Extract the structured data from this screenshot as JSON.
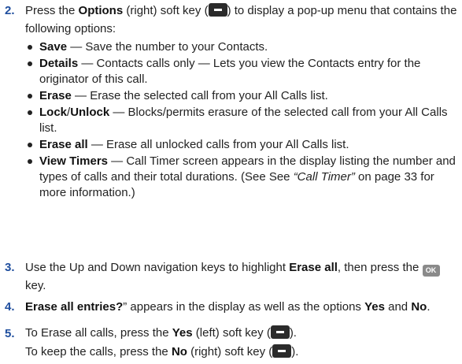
{
  "steps": {
    "s2": {
      "num": "2.",
      "p1": "Press the ",
      "b1": "Options",
      "p2": " (right) soft key (",
      "p3": ") to display a pop-up menu that contains the following options:",
      "bullets": [
        {
          "bold": "Save",
          "text": " — Save the number to your Contacts."
        },
        {
          "bold": "Details",
          "text": " — Contacts calls only — Lets you view the Contacts entry for the originator of this call."
        },
        {
          "bold": "Erase",
          "text": " — Erase the selected call from your All Calls list."
        },
        {
          "bold": "Lock",
          "slash": "/",
          "bold2": "Unlock",
          "text": " — Blocks/permits erasure of the selected call from your All Calls list."
        },
        {
          "bold": "Erase all",
          "text": " — Erase all unlocked calls from your All Calls list."
        },
        {
          "bold": "View Timers",
          "text": " — Call Timer screen appears in the display listing the number and types of calls and their total durations. (See See ",
          "italic": "“Call Timer”",
          "text2": " on page 33 for more information.)"
        }
      ]
    },
    "s3": {
      "num": "3.",
      "p1": "Use the Up and Down navigation keys to highlight ",
      "b1": "Erase all",
      "p2": ", then press the ",
      "key": "OK",
      "p3": " key."
    },
    "s4": {
      "num": "4.",
      "b1": "Erase all entries?",
      "p1": "” appears in the display as well as the options ",
      "b2": "Yes",
      "p2": " and ",
      "b3": "No",
      "p3": "."
    },
    "s5": {
      "num": "5.",
      "p1": "To Erase all calls, press the ",
      "b1": "Yes",
      "p2": " (left) soft key (",
      "p3": ").",
      "q1": "To keep the calls, press the ",
      "b2": "No",
      "q2": " (right) soft key (",
      "q3": ")."
    }
  },
  "icons": {
    "softkey": "softkey-icon",
    "ok": "ok-key-icon"
  },
  "colors": {
    "step_number": "#1f4e9e",
    "softkey": "#2b2b2b",
    "ok_key": "#8a8a8a"
  }
}
